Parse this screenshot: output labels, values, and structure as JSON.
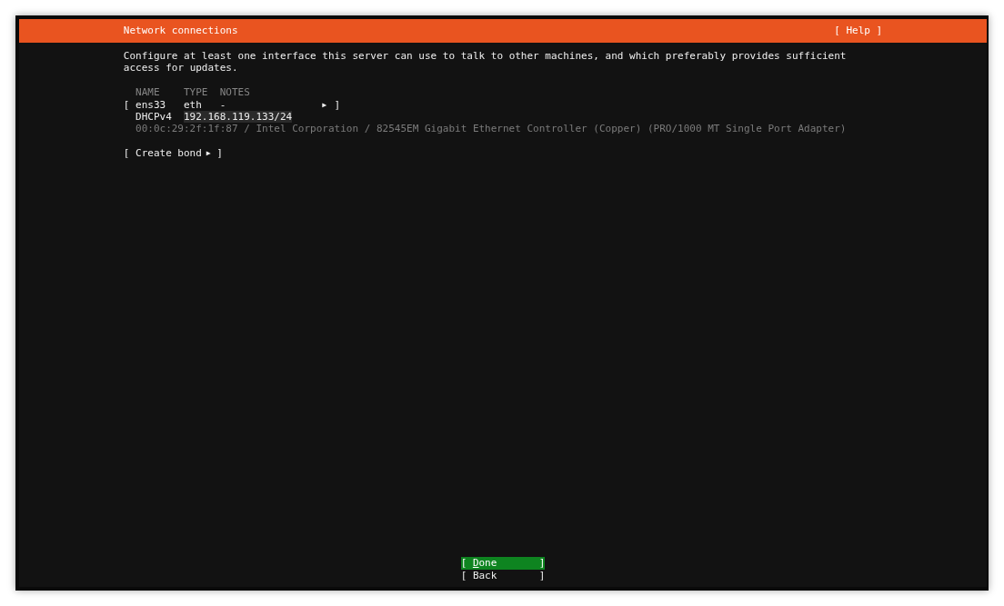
{
  "header": {
    "title": "Network connections",
    "help_button": "[ Help ]"
  },
  "description": "Configure at least one interface this server can use to talk to other machines, and which preferably provides sufficient access for updates.",
  "table": {
    "columns": [
      "NAME",
      "TYPE",
      "NOTES"
    ],
    "interfaces": [
      {
        "open": "[",
        "name": "ens33",
        "type": "eth",
        "notes": "-",
        "arrow": "▶",
        "close": "]",
        "addresses": [
          {
            "method": "DHCPv4",
            "address": "192.168.119.133/24"
          }
        ],
        "device": "00:0c:29:2f:1f:87 / Intel Corporation / 82545EM Gigabit Ethernet Controller (Copper) (PRO/1000 MT Single Port Adapter)"
      }
    ]
  },
  "create_bond_button": {
    "open": "[",
    "label": "Create bond",
    "arrow": "▶",
    "close": "]"
  },
  "buttons": [
    {
      "open": "[",
      "label": "Done",
      "close": "]",
      "selected": true
    },
    {
      "open": "[",
      "label": "Back",
      "close": "]",
      "selected": false
    }
  ]
}
